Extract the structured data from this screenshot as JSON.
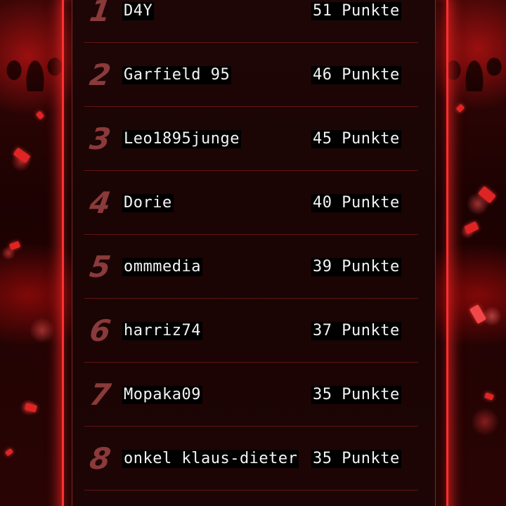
{
  "leaderboard": {
    "points_suffix": "Punkte",
    "entries": [
      {
        "rank": "1",
        "name": "D4Y",
        "points": "51 Punkte"
      },
      {
        "rank": "2",
        "name": "Garfield 95",
        "points": "46 Punkte"
      },
      {
        "rank": "3",
        "name": "Leo1895junge",
        "points": "45 Punkte"
      },
      {
        "rank": "4",
        "name": "Dorie",
        "points": "40 Punkte"
      },
      {
        "rank": "5",
        "name": "ommmedia",
        "points": "39 Punkte"
      },
      {
        "rank": "6",
        "name": "harriz74",
        "points": "37 Punkte"
      },
      {
        "rank": "7",
        "name": "Mopaka09",
        "points": "35 Punkte"
      },
      {
        "rank": "8",
        "name": "onkel klaus-dieter",
        "points": "35 Punkte"
      }
    ]
  },
  "colors": {
    "accent": "#ff3030",
    "panel": "#1f0606",
    "rank_text": "#8a3a3a",
    "entry_text": "#f4f4f4"
  }
}
